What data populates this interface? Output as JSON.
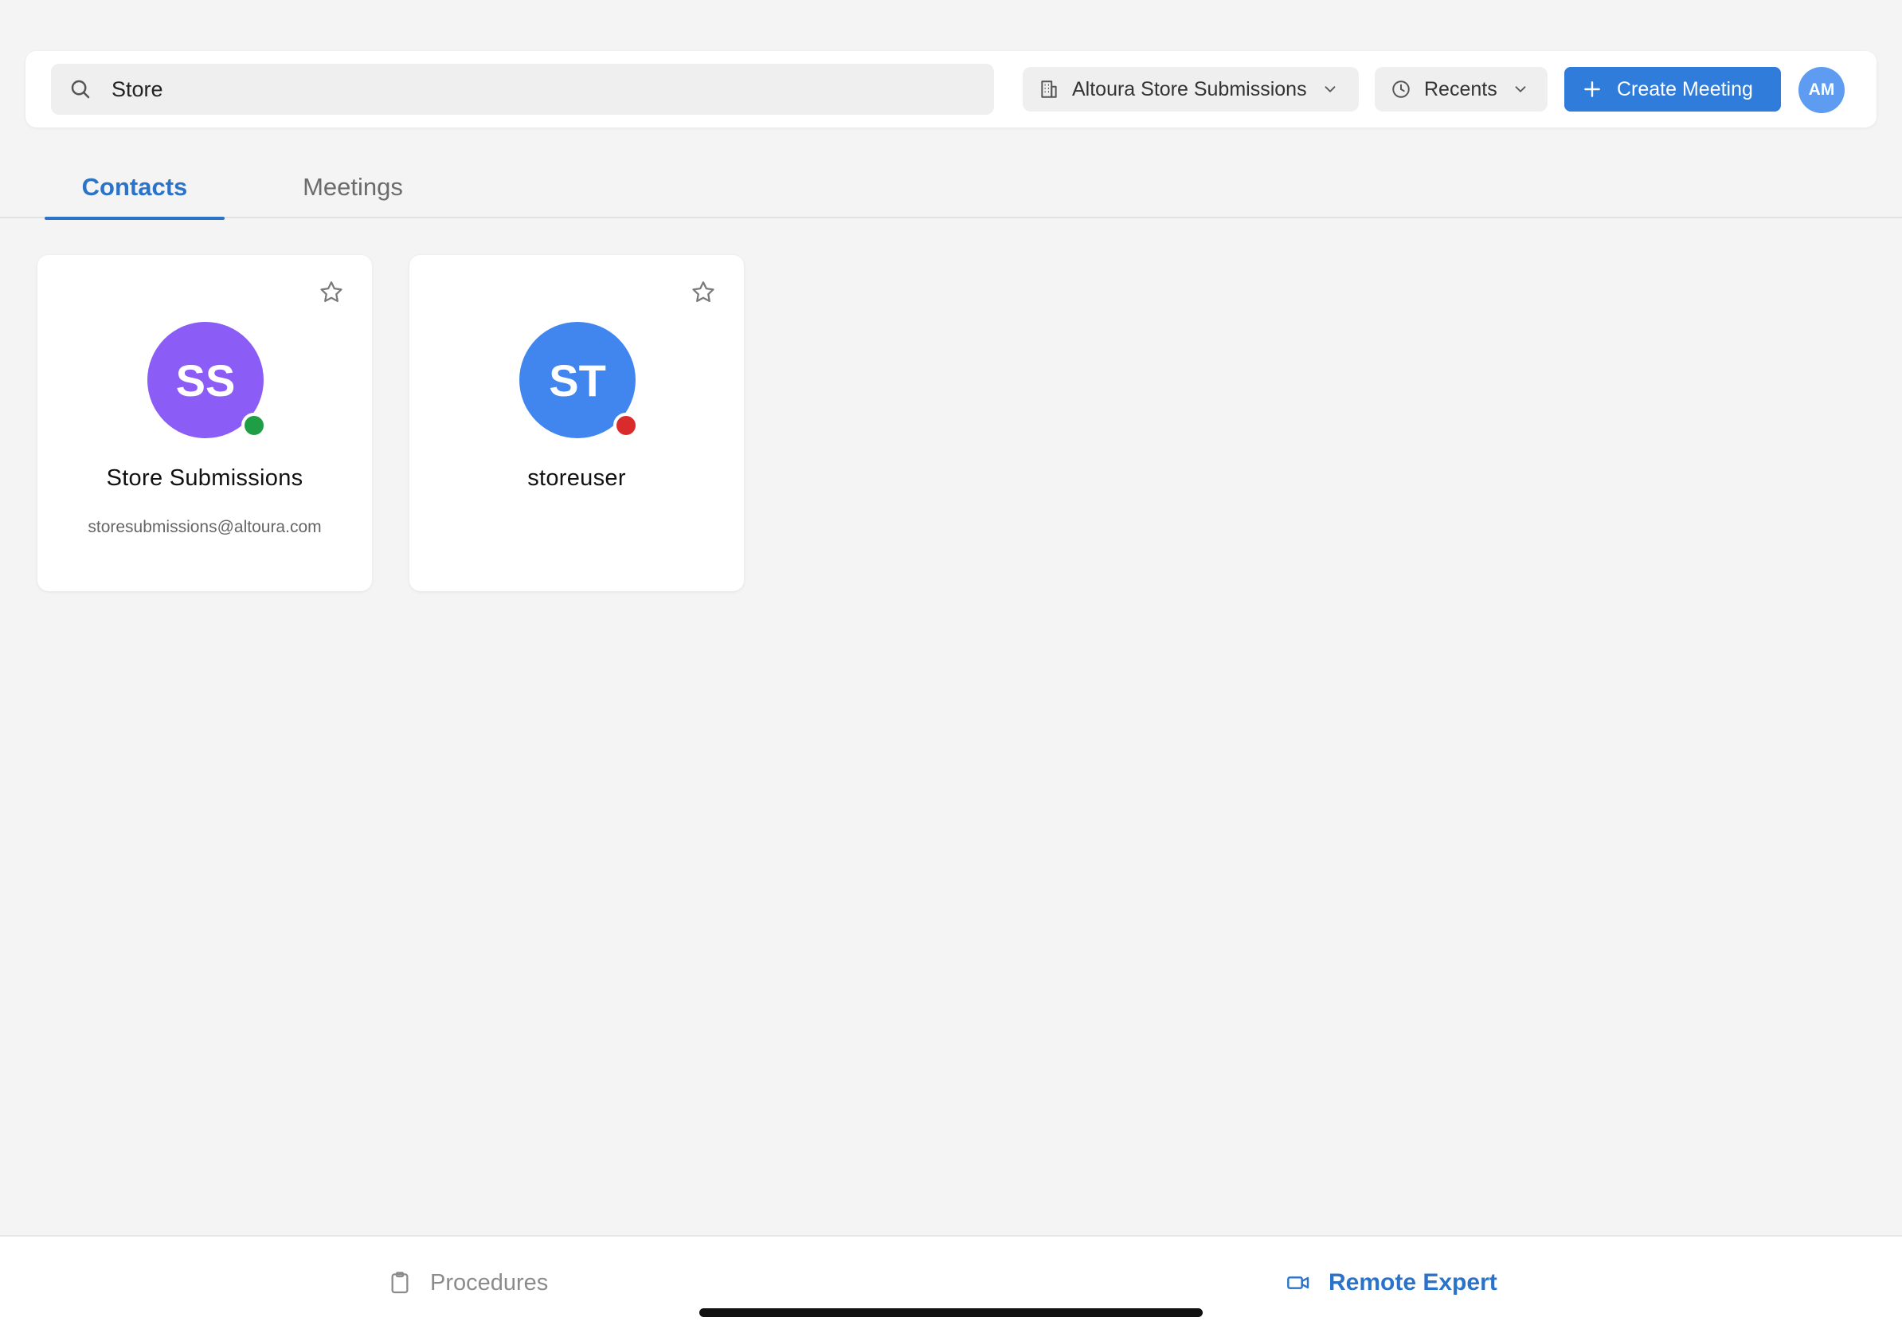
{
  "header": {
    "search": {
      "value": "Store",
      "placeholder": "Search"
    },
    "workspace_dropdown": {
      "label": "Altoura Store Submissions",
      "icon": "building-icon"
    },
    "sort_dropdown": {
      "label": "Recents",
      "icon": "clock-icon"
    },
    "create_button": {
      "label": "Create Meeting",
      "icon": "plus-icon"
    },
    "user_avatar": {
      "initials": "AM",
      "color": "#5d9cf0"
    }
  },
  "tabs": [
    {
      "label": "Contacts",
      "active": true
    },
    {
      "label": "Meetings",
      "active": false
    }
  ],
  "contacts": [
    {
      "initials": "SS",
      "name": "Store Submissions",
      "email": "storesubmissions@altoura.com",
      "avatar_color": "#8b5cf6",
      "status": "online",
      "status_color": "#1f9e45",
      "favorite": false
    },
    {
      "initials": "ST",
      "name": "storeuser",
      "email": "",
      "avatar_color": "#4186ef",
      "status": "busy",
      "status_color": "#d92b2b",
      "favorite": false
    }
  ],
  "bottom_nav": [
    {
      "label": "Procedures",
      "icon": "clipboard-icon",
      "active": false
    },
    {
      "label": "Remote Expert",
      "icon": "video-camera-icon",
      "active": true
    }
  ],
  "colors": {
    "accent": "#2f7cdb",
    "active_tab": "#2a73c9",
    "background": "#f4f4f4"
  }
}
